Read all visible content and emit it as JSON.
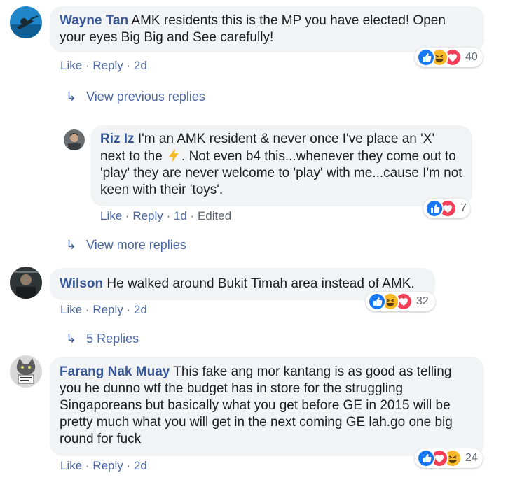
{
  "comments": [
    {
      "author": "Wayne Tan",
      "text": "AMK residents this is the MP you have elected! Open your eyes Big Big and See carefully!",
      "like": "Like",
      "reply": "Reply",
      "time": "2d",
      "reaction_count": "40"
    },
    {
      "author": "Riz Iz",
      "text_before": "I'm an AMK resident & never once I've place an 'X' next to the",
      "text_after": ". Not even b4 this...whenever they come out to 'play' they are never welcome to 'play' with me...cause I'm not keen with their 'toys'.",
      "like": "Like",
      "reply": "Reply",
      "time": "1d",
      "edited": "Edited",
      "reaction_count": "7"
    },
    {
      "author": "Wilson",
      "text": "He walked around Bukit Timah area instead of AMK.",
      "like": "Like",
      "reply": "Reply",
      "time": "2d",
      "reaction_count": "32"
    },
    {
      "author": "Farang Nak Muay",
      "text": "This fake ang mor kantang is as good as telling you he dunno wtf the budget has in store for the struggling Singaporeans but basically what you get before GE in 2015 will be pretty much what you will get in the next coming GE lah.go one big round for fuck",
      "like": "Like",
      "reply": "Reply",
      "time": "2d",
      "reaction_count": "24"
    }
  ],
  "reply_links": {
    "previous": "View previous replies",
    "more": "View more replies",
    "count": "5 Replies"
  },
  "icons": {
    "reply_arrow": "reply-arrow-icon",
    "like": "like-reaction-icon",
    "haha": "haha-reaction-icon",
    "love": "love-reaction-icon",
    "lightning": "lightning-emoji"
  },
  "colors": {
    "author": "#385898",
    "link": "#4b67a1",
    "bubble": "#f2f3f5",
    "like_blue": "#1877f2",
    "love_red": "#f33e58",
    "haha_yellow": "#f7b928"
  }
}
